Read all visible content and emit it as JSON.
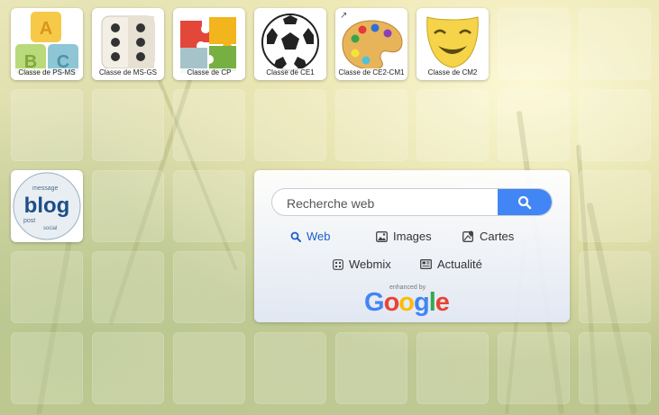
{
  "tiles": [
    {
      "id": "ps-ms",
      "label": "Classe de PS-MS",
      "icon": "abc-blocks-icon"
    },
    {
      "id": "ms-gs",
      "label": "Classe de MS-GS",
      "icon": "dice-icon"
    },
    {
      "id": "cp",
      "label": "Classe de CP",
      "icon": "puzzle-icon"
    },
    {
      "id": "ce1",
      "label": "Classe de CE1",
      "icon": "soccer-ball-icon"
    },
    {
      "id": "ce2-cm1",
      "label": "Classe de CE2-CM1",
      "icon": "palette-icon"
    },
    {
      "id": "cm2",
      "label": "Classe de CM2",
      "icon": "theater-mask-icon"
    },
    {
      "id": "blog",
      "label": "",
      "icon": "blog-word-cloud-icon"
    }
  ],
  "blog_icon_text": "blog",
  "search": {
    "placeholder": "Recherche web",
    "options": [
      {
        "label": "Web",
        "icon": "search-icon",
        "active": true
      },
      {
        "label": "Images",
        "icon": "image-icon",
        "active": false
      },
      {
        "label": "Cartes",
        "icon": "map-icon",
        "active": false
      },
      {
        "label": "Webmix",
        "icon": "grid-icon",
        "active": false
      },
      {
        "label": "Actualité",
        "icon": "newspaper-icon",
        "active": false
      }
    ],
    "enhanced_by": "enhanced by",
    "google": "Google"
  },
  "colors": {
    "accent": "#4285f4",
    "active_option": "#1a5fc8"
  }
}
